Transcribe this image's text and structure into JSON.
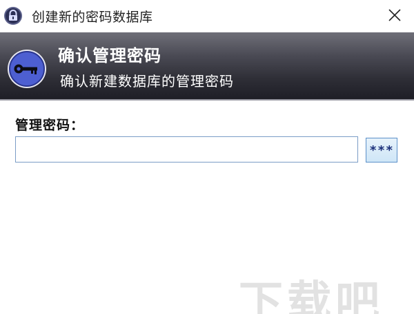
{
  "window": {
    "title": "创建新的密码数据库",
    "close_symbol": "✕"
  },
  "banner": {
    "title": "确认管理密码",
    "subtitle": "确认新建数据库的管理密码"
  },
  "form": {
    "label": "管理密码：",
    "password_value": "",
    "reveal_label": "***"
  },
  "watermark": {
    "text": "下载吧"
  },
  "colors": {
    "banner_dark": "#1e1e26",
    "banner_light": "#6f6f78",
    "key_blue": "#4d5fd1",
    "reveal_text": "#1b2f7a"
  },
  "icons": {
    "app_icon": "lock-icon",
    "banner_icon": "key-icon",
    "close": "close-icon"
  }
}
